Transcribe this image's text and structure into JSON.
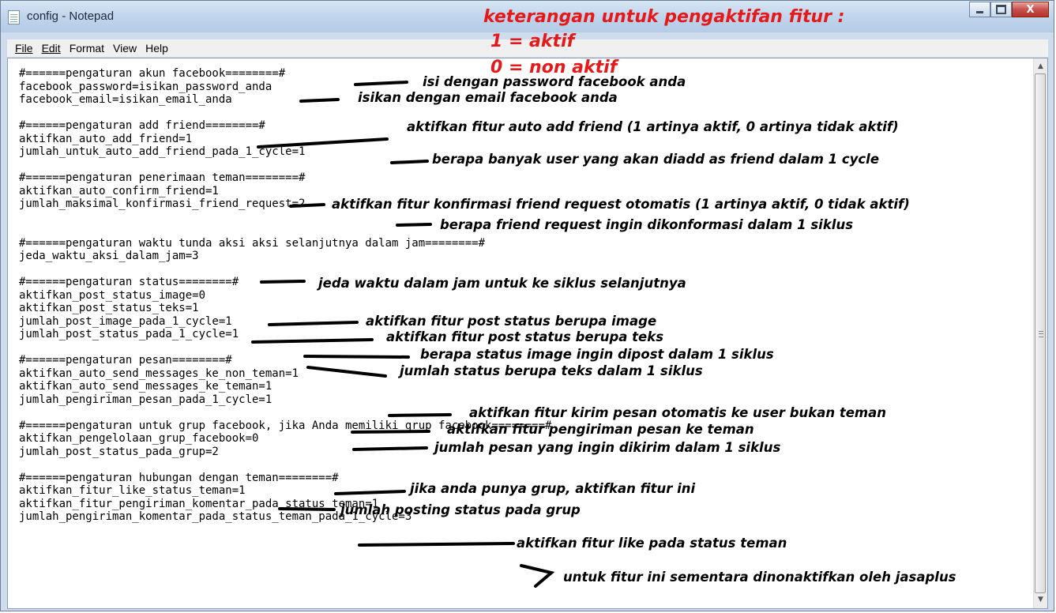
{
  "window": {
    "title": "config - Notepad",
    "minimize_label": "",
    "maximize_label": "",
    "close_label": "X"
  },
  "menu": {
    "file": "File",
    "edit": "Edit",
    "format": "Format",
    "view": "View",
    "help": "Help"
  },
  "header": {
    "line1": "keterangan untuk pengaktifan fitur :",
    "line2": "1 = aktif",
    "line3": "0 = non aktif"
  },
  "content": "#======pengaturan akun facebook========#\nfacebook_password=isikan_password_anda\nfacebook_email=isikan_email_anda\n\n#======pengaturan add friend========#\naktifkan_auto_add_friend=1\njumlah_untuk_auto_add_friend_pada_1_cycle=1\n\n#======pengaturan penerimaan teman========#\naktifkan_auto_confirm_friend=1\njumlah_maksimal_konfirmasi_friend_request=2\n\n\n#======pengaturan waktu tunda aksi aksi selanjutnya dalam jam========#\njeda_waktu_aksi_dalam_jam=3\n\n#======pengaturan status========#\naktifkan_post_status_image=0\naktifkan_post_status_teks=1\njumlah_post_image_pada_1_cycle=1\njumlah_post_status_pada_1_cycle=1\n\n#======pengaturan pesan========#\naktifkan_auto_send_messages_ke_non_teman=1\naktifkan_auto_send_messages_ke_teman=1\njumlah_pengiriman_pesan_pada_1_cycle=1\n\n#======pengaturan untuk grup facebook, jika Anda memiliki grup facebook========#\naktifkan_pengelolaan_grup_facebook=0\njumlah_post_status_pada_grup=2\n\n#======pengaturan hubungan dengan teman========#\naktifkan_fitur_like_status_teman=1\naktifkan_fitur_pengiriman_komentar_pada_status_teman=1\njumlah_pengiriman_komentar_pada_status_teman_pada_1_cycle=3",
  "annotations": [
    "isi dengan password facebook anda",
    "isikan dengan email facebook anda",
    "aktifkan fitur auto add friend (1 artinya aktif, 0 artinya tidak aktif)",
    "berapa banyak user yang akan diadd as friend dalam 1 cycle",
    "aktifkan fitur konfirmasi friend request otomatis (1 artinya aktif, 0 tidak aktif)",
    "berapa friend request ingin dikonformasi dalam 1 siklus",
    "jeda waktu dalam jam untuk ke siklus selanjutnya",
    "aktifkan fitur post status berupa image",
    "aktifkan fitur post status berupa teks",
    "berapa status image ingin dipost dalam 1 siklus",
    "jumlah status berupa teks dalam 1 siklus",
    "aktifkan fitur kirim pesan otomatis ke user bukan teman",
    "aktifkan fitur pengiriman pesan ke teman",
    "jumlah pesan yang ingin dikirim dalam 1 siklus",
    "jika anda punya grup, aktifkan fitur ini",
    "jumlah posting status pada grup",
    "aktifkan fitur like pada status teman",
    "untuk fitur ini sementara dinonaktifkan oleh jasaplus"
  ],
  "colors": {
    "header_text": "#e51919",
    "annotation_text": "#000000"
  }
}
